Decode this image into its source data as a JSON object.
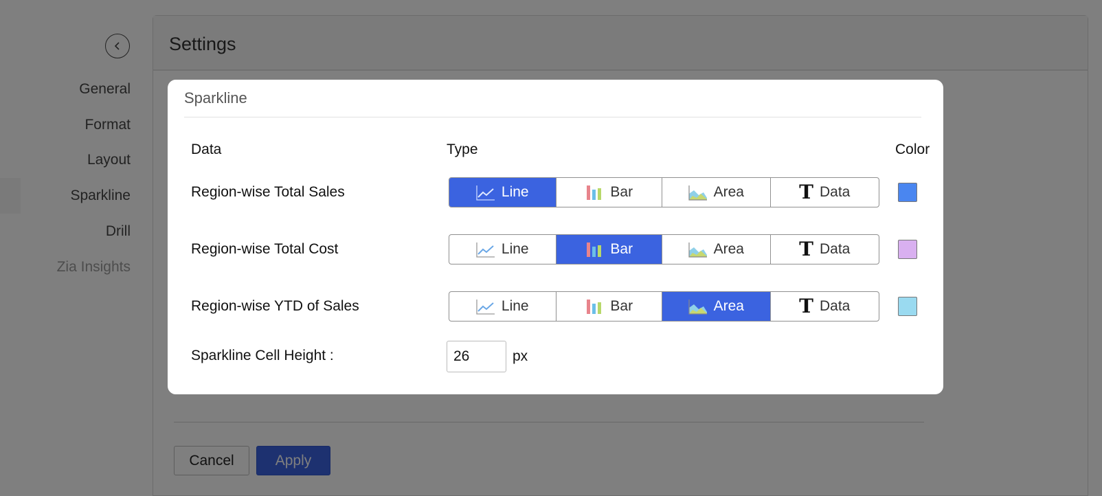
{
  "sidebar": {
    "items": [
      {
        "label": "General"
      },
      {
        "label": "Format"
      },
      {
        "label": "Layout"
      },
      {
        "label": "Sparkline"
      },
      {
        "label": "Drill"
      },
      {
        "label": "Zia Insights"
      }
    ],
    "active": "Sparkline"
  },
  "main": {
    "title": "Settings",
    "cancel_label": "Cancel",
    "apply_label": "Apply"
  },
  "modal": {
    "title": "Sparkline",
    "columns": {
      "data": "Data",
      "type": "Type",
      "color": "Color"
    },
    "type_options": [
      "Line",
      "Bar",
      "Area",
      "Data"
    ],
    "rows": [
      {
        "label": "Region-wise Total Sales",
        "selected": "Line",
        "color": "#4a86f0"
      },
      {
        "label": "Region-wise Total Cost",
        "selected": "Bar",
        "color": "#d9b0f0"
      },
      {
        "label": "Region-wise YTD of Sales",
        "selected": "Area",
        "color": "#9adaf0"
      }
    ],
    "cell_height": {
      "label": "Sparkline Cell Height :",
      "value": "26",
      "unit": "px"
    }
  },
  "colors": {
    "accent": "#3b63e0",
    "overlay": "rgba(0,0,0,0.5)"
  },
  "icons": {
    "back": "chevron-left-icon",
    "line": "line-chart-icon",
    "bar": "bar-chart-icon",
    "area": "area-chart-icon",
    "data": "text-data-icon"
  }
}
